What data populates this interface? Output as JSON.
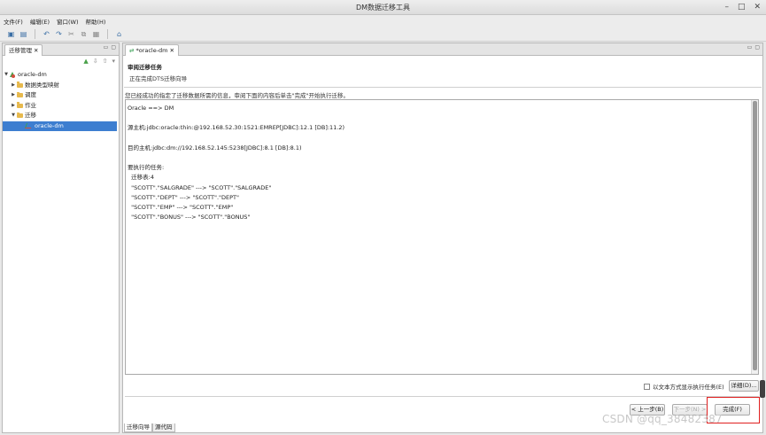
{
  "window": {
    "title": "DM数据迁移工具",
    "minimize": "–",
    "maximize": "□",
    "close": "✕"
  },
  "menu": [
    "文件(F)",
    "编辑(E)",
    "窗口(W)",
    "帮助(H)"
  ],
  "toolbar_icons": [
    "save-icon",
    "save-all-icon",
    "undo-icon",
    "redo-icon",
    "cut-icon",
    "copy-icon",
    "paste-icon",
    "home-icon"
  ],
  "left_panel": {
    "tab_label": "迁移管理",
    "tab_close": "✕",
    "tree": {
      "root": "oracle-dm",
      "children": [
        "数据类型映射",
        "调度",
        "作业",
        "迁移"
      ],
      "selected_leaf": "oracle-dm"
    }
  },
  "editor": {
    "tab_label": "*oracle-dm",
    "tab_close": "✕",
    "wizard_title": "审阅迁移任务",
    "wizard_subtitle": "正在完成DTS迁移向导",
    "description": "您已经成功的指定了迁移数据所需的信息，审阅下面的内容后单击\"完成\"开始执行迁移。",
    "content": "Oracle ==> DM\n\n源主机:jdbc:oracle:thin:@192.168.52.30:1521:EMREP[JDBC]:12.1 [DB]:11.2)\n\n目的主机:jdbc:dm://192.168.52.145:5238[JDBC]:8.1 [DB]:8.1)\n\n要执行的任务:\n  迁移表:4\n  \"SCOTT\".\"SALGRADE\" ---> \"SCOTT\".\"SALGRADE\"\n  \"SCOTT\".\"DEPT\" ---> \"SCOTT\".\"DEPT\"\n  \"SCOTT\".\"EMP\" ---> \"SCOTT\".\"EMP\"\n  \"SCOTT\".\"BONUS\" ---> \"SCOTT\".\"BONUS\"",
    "show_text_option": "以文本方式显示执行任务(E)",
    "detail_button": "详细(D)...",
    "prev_button": "< 上一步(B)",
    "next_button": "下一步(N) >",
    "finish_button": "完成(F)",
    "bottom_tabs": [
      "迁移向导",
      "源代码"
    ]
  },
  "watermark": "CSDN @qq_38482387"
}
